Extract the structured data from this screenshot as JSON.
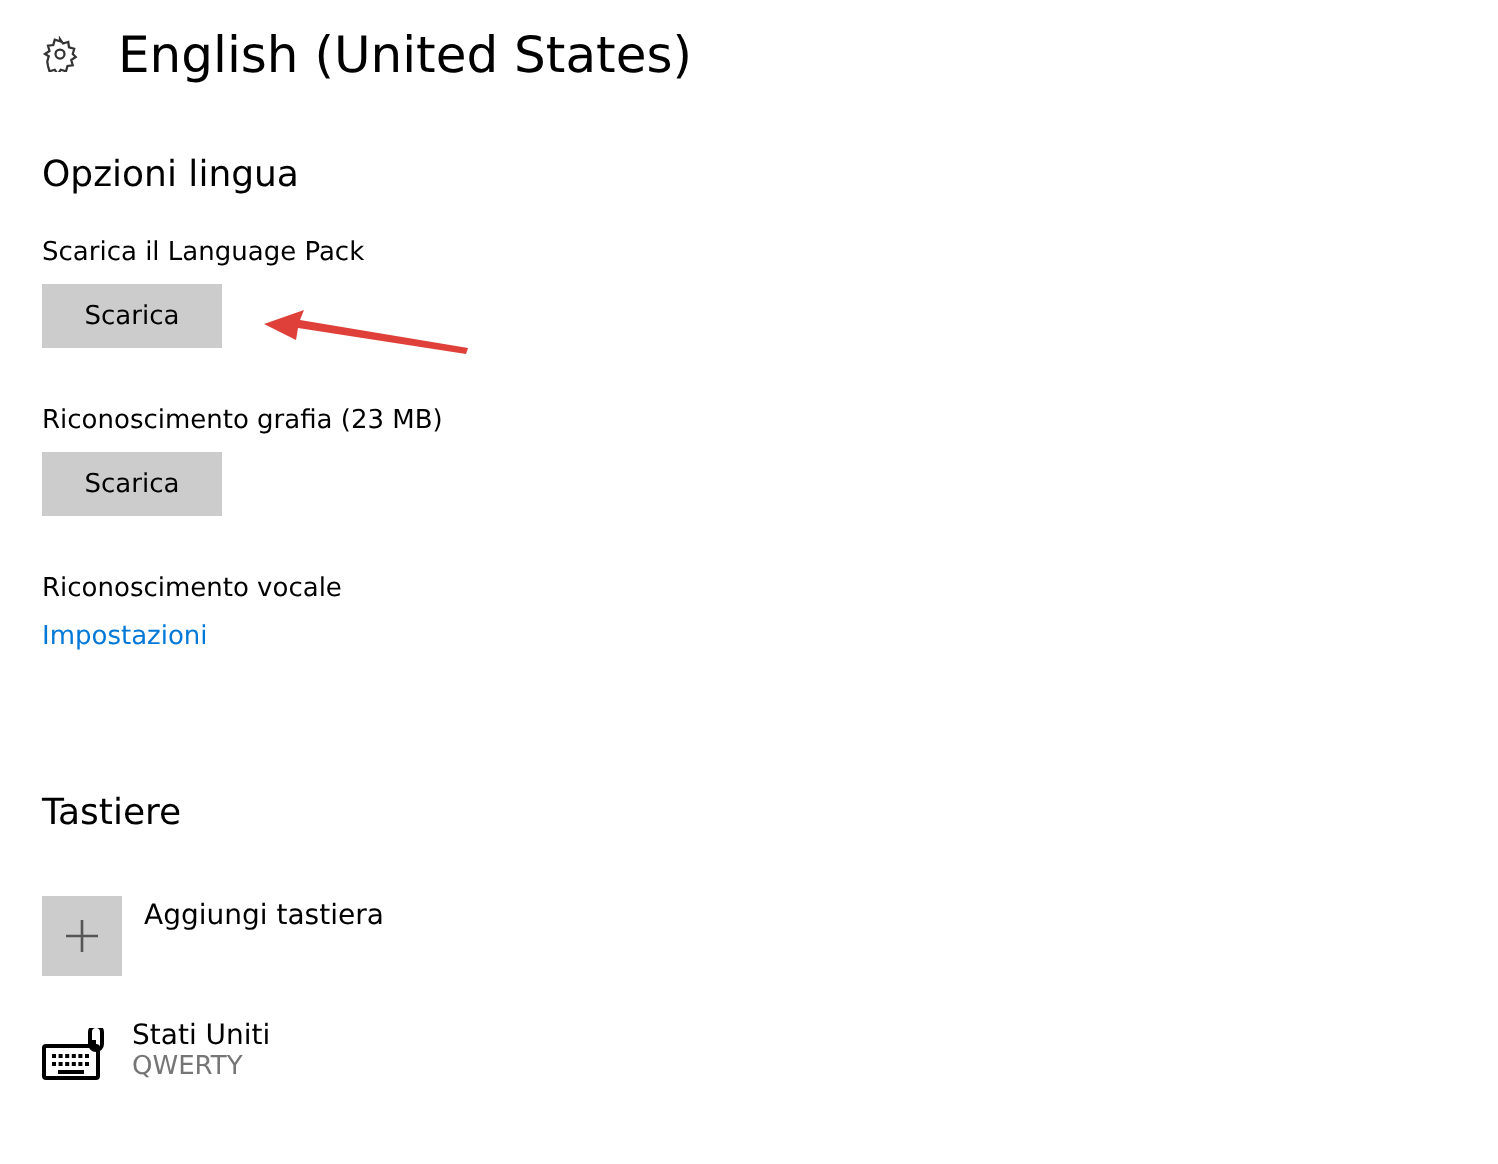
{
  "header": {
    "title": "English (United States)"
  },
  "language_options": {
    "heading": "Opzioni lingua",
    "items": [
      {
        "kind": "button",
        "label": "Scarica il Language Pack",
        "action": "Scarica"
      },
      {
        "kind": "button",
        "label": "Riconoscimento grafia (23 MB)",
        "action": "Scarica"
      },
      {
        "kind": "link",
        "label": "Riconoscimento vocale",
        "action": "Impostazioni"
      }
    ]
  },
  "keyboards": {
    "heading": "Tastiere",
    "add_label": "Aggiungi tastiera",
    "items": [
      {
        "name": "Stati Uniti",
        "layout": "QWERTY"
      }
    ]
  }
}
